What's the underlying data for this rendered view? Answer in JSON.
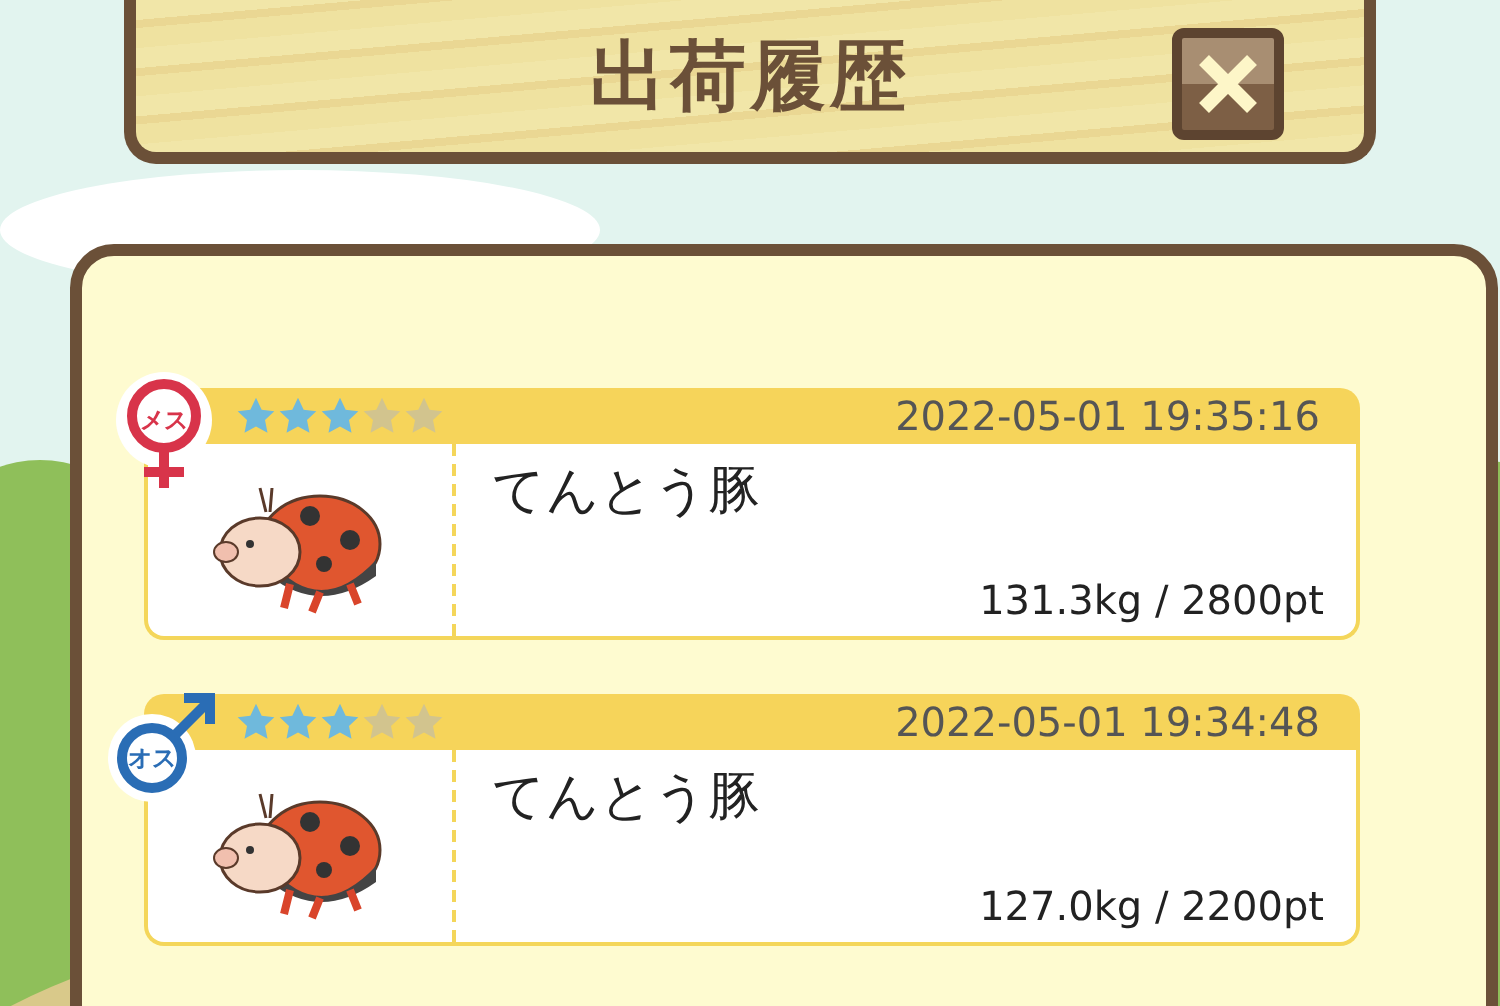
{
  "header": {
    "title": "出荷履歴"
  },
  "records": [
    {
      "gender": {
        "kind": "female",
        "label": "メス"
      },
      "stars": 3,
      "datetime": "2022-05-01 19:35:16",
      "name": "てんとう豚",
      "weight_points": "131.3kg / 2800pt"
    },
    {
      "gender": {
        "kind": "male",
        "label": "オス"
      },
      "stars": 3,
      "datetime": "2022-05-01 19:34:48",
      "name": "てんとう豚",
      "weight_points": "127.0kg / 2200pt"
    }
  ]
}
